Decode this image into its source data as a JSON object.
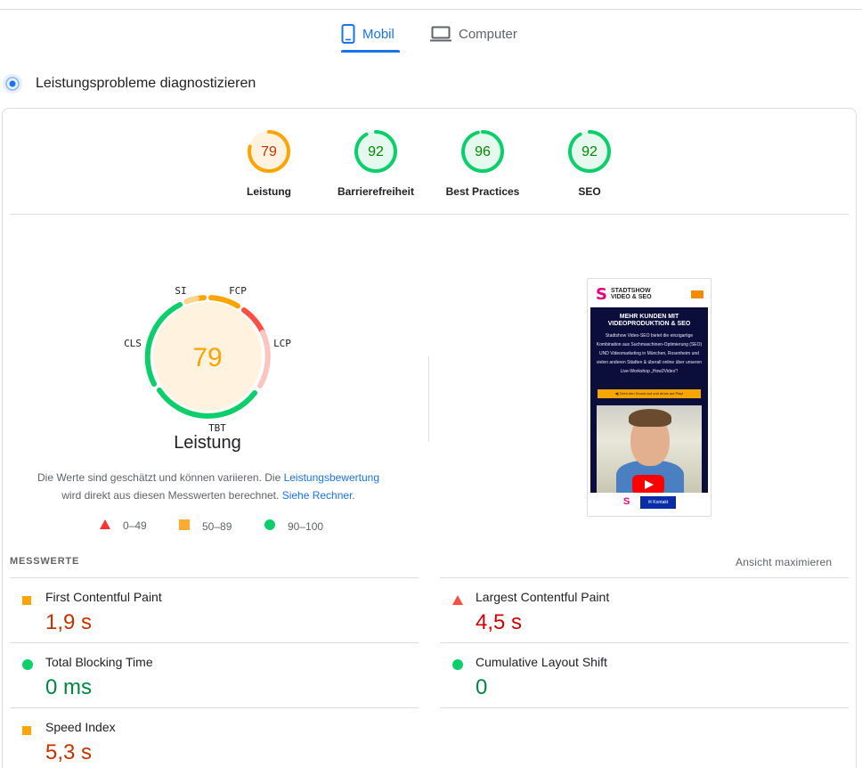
{
  "tabs": [
    {
      "label": "Mobil",
      "active": true,
      "icon": "smartphone-icon"
    },
    {
      "label": "Computer",
      "active": false,
      "icon": "laptop-icon"
    }
  ],
  "diagnose": {
    "title": "Leistungsprobleme diagnostizieren",
    "icon": "lighthouse-icon"
  },
  "categories": [
    {
      "score": "79",
      "label": "Leistung",
      "status": "average",
      "color": "#ffa400",
      "fraction": 0.79
    },
    {
      "score": "92",
      "label": "Barrierefreiheit",
      "status": "pass",
      "color": "#0cce6b",
      "fraction": 0.92
    },
    {
      "score": "96",
      "label": "Best Practices",
      "status": "pass",
      "color": "#0cce6b",
      "fraction": 0.96
    },
    {
      "score": "92",
      "label": "SEO",
      "status": "pass",
      "color": "#0cce6b",
      "fraction": 0.92
    }
  ],
  "performance": {
    "score": "79",
    "title": "Leistung",
    "segments": {
      "si": "SI",
      "fcp": "FCP",
      "lcp": "LCP",
      "tbt": "TBT",
      "cls": "CLS"
    },
    "explain_prefix": "Die Werte sind geschätzt und können variieren. Die ",
    "explain_link1": "Leistungsbewertung",
    "explain_middle": " wird direkt aus diesen Messwerten berechnet. ",
    "explain_link2": "Siehe Rechner",
    "explain_suffix": "."
  },
  "legend": [
    {
      "label": "0–49",
      "shape": "triangle",
      "color": "#ff3333"
    },
    {
      "label": "50–89",
      "shape": "square",
      "color": "#ffaa33"
    },
    {
      "label": "90–100",
      "shape": "circle",
      "color": "#0cce6b"
    }
  ],
  "preview": {
    "logo_letter": "S",
    "logo_text_1": "STADTSHOW",
    "logo_text_2": "VIDEO & SEO",
    "headline": "MEHR KUNDEN MIT VIDEOPRODUKTION & SEO",
    "body": "Stadtshow Video-SEO bietet die einzigartige Kombination aus Suchmaschinen-Optimierung (SEO) UND Videomarketing in München, Rosenheim und vielen anderen Städten & überall online über unseren Live-Workshop „How2Video“!",
    "button": "◀) Dreh den Sound auf und drück auf Play!",
    "kontakt": "✉ Kontakt"
  },
  "metrics_section": {
    "title": "MESSWERTE",
    "expand": "Ansicht maximieren"
  },
  "metrics": [
    {
      "name": "First Contentful Paint",
      "value": "1,9 s",
      "status": "average"
    },
    {
      "name": "Largest Contentful Paint",
      "value": "4,5 s",
      "status": "fail"
    },
    {
      "name": "Total Blocking Time",
      "value": "0 ms",
      "status": "pass"
    },
    {
      "name": "Cumulative Layout Shift",
      "value": "0",
      "status": "pass"
    },
    {
      "name": "Speed Index",
      "value": "5,3 s",
      "status": "average"
    }
  ],
  "colors": {
    "accent": "#1a73e8",
    "pass": "#0cce6b",
    "average": "#ffa400",
    "fail": "#ff4e42"
  }
}
